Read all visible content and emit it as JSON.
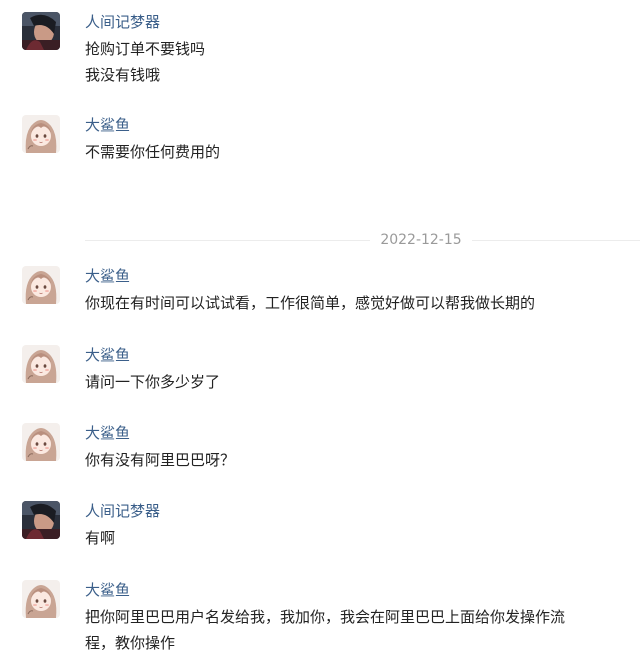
{
  "messages": [
    {
      "sender": "人间记梦器",
      "lines": [
        "抢购订单不要钱吗",
        "我没有钱哦"
      ],
      "avatar": "dark-photo-avatar"
    },
    {
      "sender": "大鲨鱼",
      "lines": [
        "不需要你任何费用的"
      ],
      "avatar": "anime-girl-avatar"
    },
    {
      "sender": "大鲨鱼",
      "lines": [
        "你现在有时间可以试试看，工作很简单，感觉好做可以帮我做长期的"
      ],
      "avatar": "anime-girl-avatar"
    },
    {
      "sender": "大鲨鱼",
      "lines": [
        "请问一下你多少岁了"
      ],
      "avatar": "anime-girl-avatar"
    },
    {
      "sender": "大鲨鱼",
      "lines": [
        "你有没有阿里巴巴呀？"
      ],
      "avatar": "anime-girl-avatar"
    },
    {
      "sender": "人间记梦器",
      "lines": [
        "有啊"
      ],
      "avatar": "dark-photo-avatar"
    },
    {
      "sender": "大鲨鱼",
      "lines": [
        "把你阿里巴巴用户名发给我，我加你，我会在阿里巴巴上面给你发操作流",
        "程，教你操作"
      ],
      "avatar": "anime-girl-avatar"
    }
  ],
  "date_divider": {
    "label": "2022-12-15",
    "after_message": 1
  },
  "colors": {
    "sender_name": "#3b5f8a",
    "message_text": "#222222",
    "date_text": "#9a9a9a",
    "divider_line": "#ececec",
    "background": "#ffffff"
  }
}
